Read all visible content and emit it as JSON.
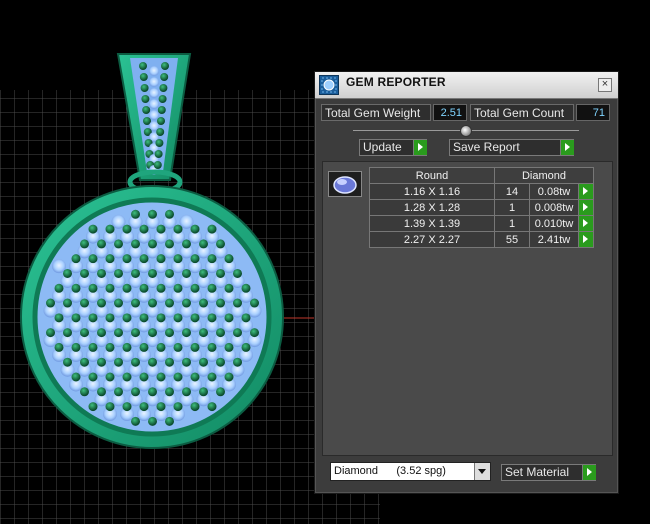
{
  "window": {
    "title": "GEM REPORTER",
    "close_label": "×"
  },
  "summary": {
    "total_weight_label": "Total Gem Weight",
    "total_weight_value": "2.51",
    "total_count_label": "Total Gem Count",
    "total_count_value": "71"
  },
  "buttons": {
    "update_label": "Update",
    "save_report_label": "Save Report",
    "set_material_label": "Set Material"
  },
  "gem_table": {
    "shape_header": "Round",
    "material_header": "Diamond",
    "rows": [
      {
        "size": "1.16 X 1.16",
        "count": "14",
        "weight": "0.08tw"
      },
      {
        "size": "1.28 X 1.28",
        "count": "1",
        "weight": "0.008tw"
      },
      {
        "size": "1.39 X 1.39",
        "count": "1",
        "weight": "0.010tw"
      },
      {
        "size": "2.27 X 2.27",
        "count": "55",
        "weight": "2.41tw"
      }
    ]
  },
  "material_select": {
    "value": "Diamond      (3.52 spg)"
  },
  "colors": {
    "metal": "#1fa57d",
    "gem_light": "#a9d0ff",
    "gem_dark": "#0f5a3a",
    "accent_green": "#2a9b1d",
    "value_text": "#7fd4ff"
  },
  "icons": {
    "app": "gem-reporter-icon",
    "gem_thumbnail": "round-diamond-icon"
  }
}
